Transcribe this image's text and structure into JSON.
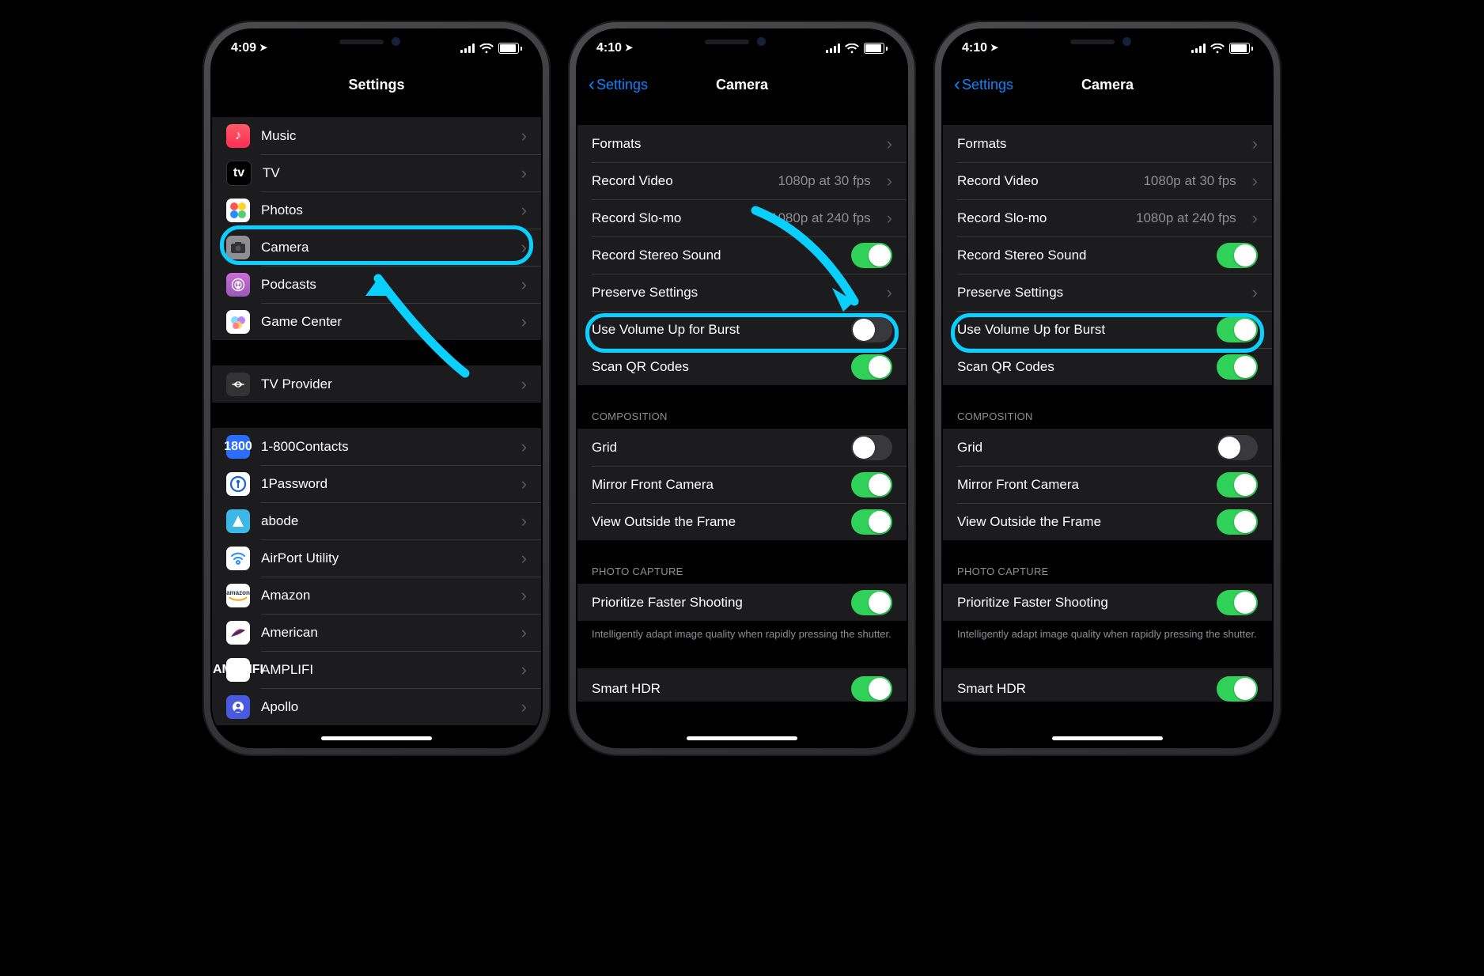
{
  "colors": {
    "highlight": "#0ad0ff",
    "link": "#0a84ff",
    "toggle_on": "#30d158"
  },
  "screen1": {
    "time": "4:09",
    "title": "Settings",
    "highlight_row": "camera",
    "group1": [
      {
        "key": "music",
        "label": "Music",
        "type": "chevron"
      },
      {
        "key": "tv",
        "label": "TV",
        "type": "chevron"
      },
      {
        "key": "photos",
        "label": "Photos",
        "type": "chevron"
      },
      {
        "key": "camera",
        "label": "Camera",
        "type": "chevron"
      },
      {
        "key": "podcasts",
        "label": "Podcasts",
        "type": "chevron"
      },
      {
        "key": "gamecenter",
        "label": "Game Center",
        "type": "chevron"
      }
    ],
    "group2": [
      {
        "key": "tvprovider",
        "label": "TV Provider",
        "type": "chevron"
      }
    ],
    "group3": [
      {
        "key": "1800",
        "label": "1-800Contacts",
        "type": "chevron"
      },
      {
        "key": "1password",
        "label": "1Password",
        "type": "chevron"
      },
      {
        "key": "abode",
        "label": "abode",
        "type": "chevron"
      },
      {
        "key": "airport",
        "label": "AirPort Utility",
        "type": "chevron"
      },
      {
        "key": "amazon",
        "label": "Amazon",
        "type": "chevron"
      },
      {
        "key": "american",
        "label": "American",
        "type": "chevron"
      },
      {
        "key": "amplifi",
        "label": "AMPLIFI",
        "type": "chevron"
      },
      {
        "key": "apollo",
        "label": "Apollo",
        "type": "chevron"
      }
    ]
  },
  "screen2": {
    "time": "4:10",
    "back_label": "Settings",
    "title": "Camera",
    "highlight_row": "burst",
    "sections": {
      "top": [
        {
          "key": "formats",
          "label": "Formats",
          "type": "chevron"
        },
        {
          "key": "record_video",
          "label": "Record Video",
          "type": "detail",
          "detail": "1080p at 30 fps"
        },
        {
          "key": "record_slomo",
          "label": "Record Slo-mo",
          "type": "detail",
          "detail": "1080p at 240 fps"
        },
        {
          "key": "stereo",
          "label": "Record Stereo Sound",
          "type": "toggle",
          "on": true
        },
        {
          "key": "preserve",
          "label": "Preserve Settings",
          "type": "chevron"
        },
        {
          "key": "burst",
          "label": "Use Volume Up for Burst",
          "type": "toggle",
          "on": false
        },
        {
          "key": "qr",
          "label": "Scan QR Codes",
          "type": "toggle",
          "on": true
        }
      ],
      "composition_header": "COMPOSITION",
      "composition": [
        {
          "key": "grid",
          "label": "Grid",
          "type": "toggle",
          "on": false
        },
        {
          "key": "mirror",
          "label": "Mirror Front Camera",
          "type": "toggle",
          "on": true
        },
        {
          "key": "outside",
          "label": "View Outside the Frame",
          "type": "toggle",
          "on": true
        }
      ],
      "capture_header": "PHOTO CAPTURE",
      "capture": [
        {
          "key": "faster",
          "label": "Prioritize Faster Shooting",
          "type": "toggle",
          "on": true
        }
      ],
      "capture_footer": "Intelligently adapt image quality when rapidly pressing the shutter.",
      "peek": {
        "label": "Smart HDR",
        "on": true
      }
    }
  },
  "screen3": {
    "time": "4:10",
    "back_label": "Settings",
    "title": "Camera",
    "highlight_row": "burst",
    "sections": {
      "top": [
        {
          "key": "formats",
          "label": "Formats",
          "type": "chevron"
        },
        {
          "key": "record_video",
          "label": "Record Video",
          "type": "detail",
          "detail": "1080p at 30 fps"
        },
        {
          "key": "record_slomo",
          "label": "Record Slo-mo",
          "type": "detail",
          "detail": "1080p at 240 fps"
        },
        {
          "key": "stereo",
          "label": "Record Stereo Sound",
          "type": "toggle",
          "on": true
        },
        {
          "key": "preserve",
          "label": "Preserve Settings",
          "type": "chevron"
        },
        {
          "key": "burst",
          "label": "Use Volume Up for Burst",
          "type": "toggle",
          "on": true
        },
        {
          "key": "qr",
          "label": "Scan QR Codes",
          "type": "toggle",
          "on": true
        }
      ],
      "composition_header": "COMPOSITION",
      "composition": [
        {
          "key": "grid",
          "label": "Grid",
          "type": "toggle",
          "on": false
        },
        {
          "key": "mirror",
          "label": "Mirror Front Camera",
          "type": "toggle",
          "on": true
        },
        {
          "key": "outside",
          "label": "View Outside the Frame",
          "type": "toggle",
          "on": true
        }
      ],
      "capture_header": "PHOTO CAPTURE",
      "capture": [
        {
          "key": "faster",
          "label": "Prioritize Faster Shooting",
          "type": "toggle",
          "on": true
        }
      ],
      "capture_footer": "Intelligently adapt image quality when rapidly pressing the shutter.",
      "peek": {
        "label": "Smart HDR",
        "on": true
      }
    }
  }
}
